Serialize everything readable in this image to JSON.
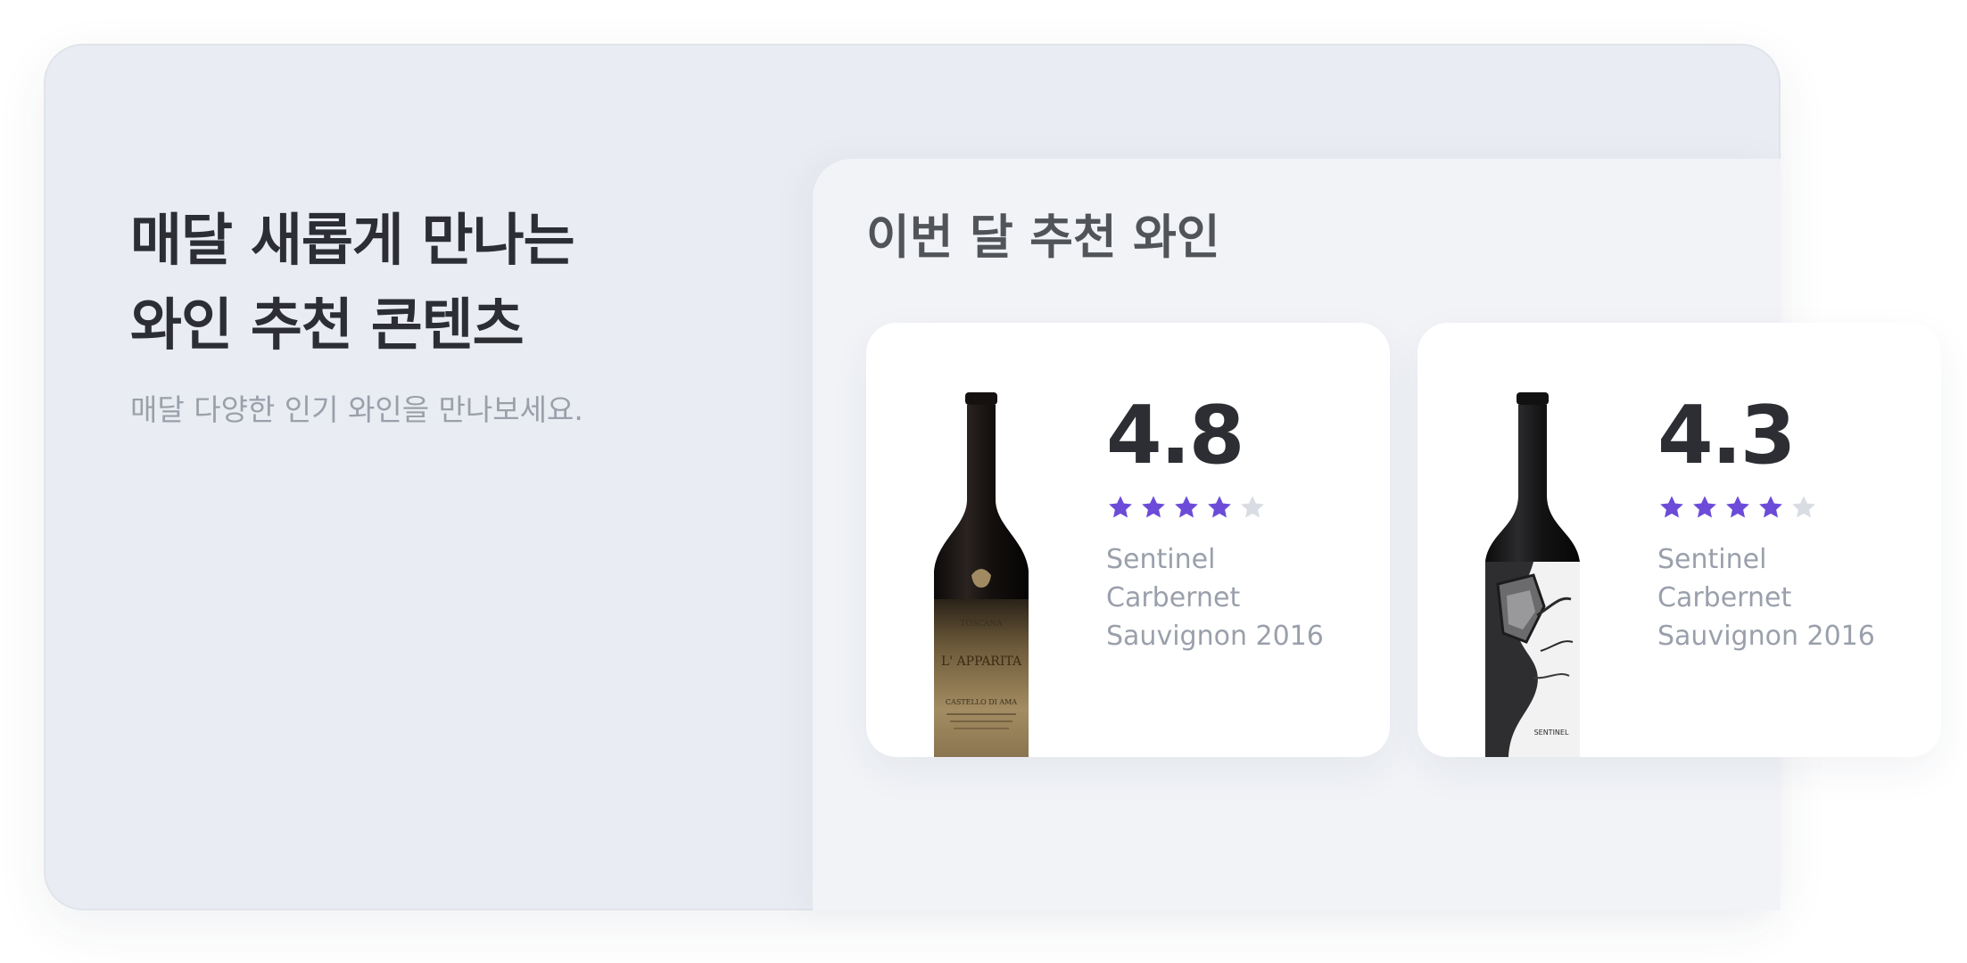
{
  "intro": {
    "title_lines": [
      "매달 새롭게 만나는",
      "와인 추천 콘텐츠"
    ],
    "subtitle": "매달 다양한 인기 와인을 만나보세요."
  },
  "recommendations": {
    "title": "이번 달 추천 와인",
    "cards": [
      {
        "rating": "4.8",
        "stars_filled": 4,
        "stars_total": 5,
        "name_lines": [
          "Sentinel",
          "Carbernet",
          "Sauvignon 2016"
        ],
        "bottle_label": "L' APPARITA",
        "bottle_label_small": "TOSCANA",
        "bottle_label_foot": "CASTELLO DI AMA"
      },
      {
        "rating": "4.3",
        "stars_filled": 4,
        "stars_total": 5,
        "name_lines": [
          "Sentinel",
          "Carbernet",
          "Sauvignon 2016"
        ],
        "bottle_label": "SENTINEL"
      }
    ]
  },
  "colors": {
    "panel_bg": "#e9ecf2",
    "rec_bg": "#f1f3f7",
    "star_filled": "#6c4bd8",
    "star_empty": "#d9dde3",
    "title_text": "#2c2e33",
    "muted_text": "#9aa0ab"
  },
  "icons": {
    "star": "star-icon",
    "bottle_1": "wine-bottle-apparita",
    "bottle_2": "wine-bottle-sentinel"
  }
}
